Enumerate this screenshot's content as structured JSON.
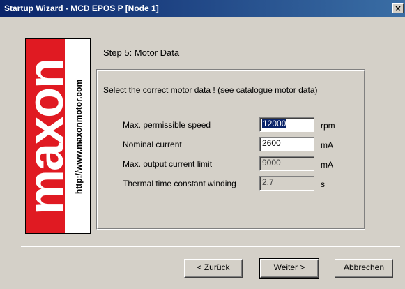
{
  "window": {
    "title": "Startup Wizard - MCD EPOS P [Node 1]",
    "close_glyph": "×"
  },
  "logo": {
    "brand": "maxon",
    "url": "http://www.maxonmotor.com",
    "brand_color": "#e01a22"
  },
  "step": {
    "title": "Step 5: Motor Data",
    "instruction": "Select the correct motor data ! (see catalogue motor data)"
  },
  "fields": [
    {
      "label": "Max. permissible speed",
      "value": "12000",
      "unit": "rpm",
      "editable": true,
      "selected": true
    },
    {
      "label": "Nominal current",
      "value": "2600",
      "unit": "mA",
      "editable": true,
      "selected": false
    },
    {
      "label": "Max. output current limit",
      "value": "9000",
      "unit": "mA",
      "editable": false,
      "selected": false
    },
    {
      "label": "Thermal time constant winding",
      "value": "2.7",
      "unit": "s",
      "editable": false,
      "selected": false
    }
  ],
  "buttons": {
    "back": "< Zurück",
    "next": "Weiter >",
    "cancel": "Abbrechen"
  }
}
